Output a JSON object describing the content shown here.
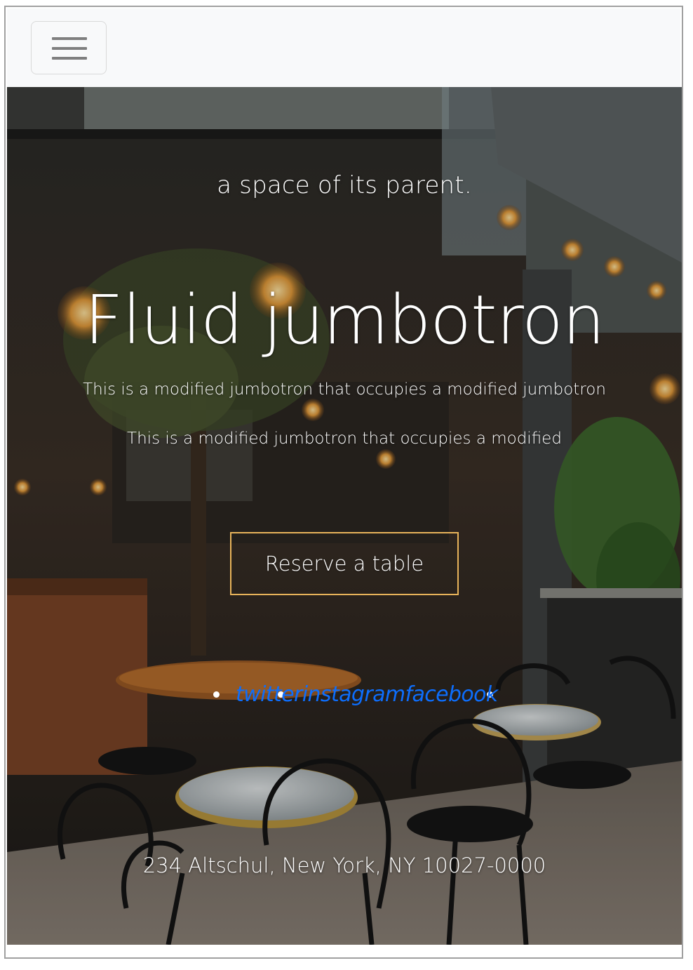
{
  "navbar": {
    "toggler_icon": "hamburger-menu-icon"
  },
  "hero": {
    "tagline": "a space of its parent.",
    "title": "Fluid jumbotron",
    "lead_1": "This is a modified jumbotron that occupies a modified jumbotron",
    "lead_2": "This is a modified jumbotron that occupies a modified",
    "cta_label": "Reserve a table",
    "background_icon": "restaurant-patio-photo"
  },
  "social": {
    "links": [
      "twitter",
      "instagram",
      "facebook"
    ]
  },
  "footer": {
    "address": "234 Altschul, New York, NY 10027-0000"
  },
  "colors": {
    "accent_border": "#e7b35a",
    "link": "#0d6efd",
    "navbar_bg": "#f8f9fa"
  }
}
